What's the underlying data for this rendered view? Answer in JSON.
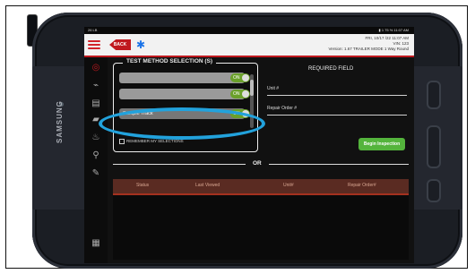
{
  "device": {
    "brand": "SAMSUNG"
  },
  "status_bar": {
    "left": "26 LB",
    "right": "▮ 1 75 % 11:07 AM"
  },
  "header": {
    "back_label": "BACK",
    "version_lines": [
      "FRI, 10/17 /22 11:07 AM",
      "VIN: 123",
      "Version: 1.67 TRAILER MODE 1 Way Round"
    ]
  },
  "test_method": {
    "title": "TEST METHOD SELECTION (S)",
    "rows": [
      {
        "label": "",
        "toggle": "ON"
      },
      {
        "label": "",
        "toggle": "ON"
      },
      {
        "label": "Sample Track",
        "toggle": "ON"
      }
    ],
    "remember": "REMEMBER MY SELECTIONS"
  },
  "required": {
    "title": "REQUIRED FIELD",
    "unit_label": "Unit #",
    "repair_order_label": "Repair Order #"
  },
  "begin_label": "Begin Inspection",
  "or_label": "OR",
  "table": {
    "columns": [
      "Status",
      "Last Viewed",
      "Unit#",
      "Repair Order#"
    ]
  },
  "colors": {
    "accent_red": "#c0191f",
    "toggle_green": "#6aa02a",
    "highlight_blue": "#22a2dc",
    "begin_green": "#54b43c"
  }
}
